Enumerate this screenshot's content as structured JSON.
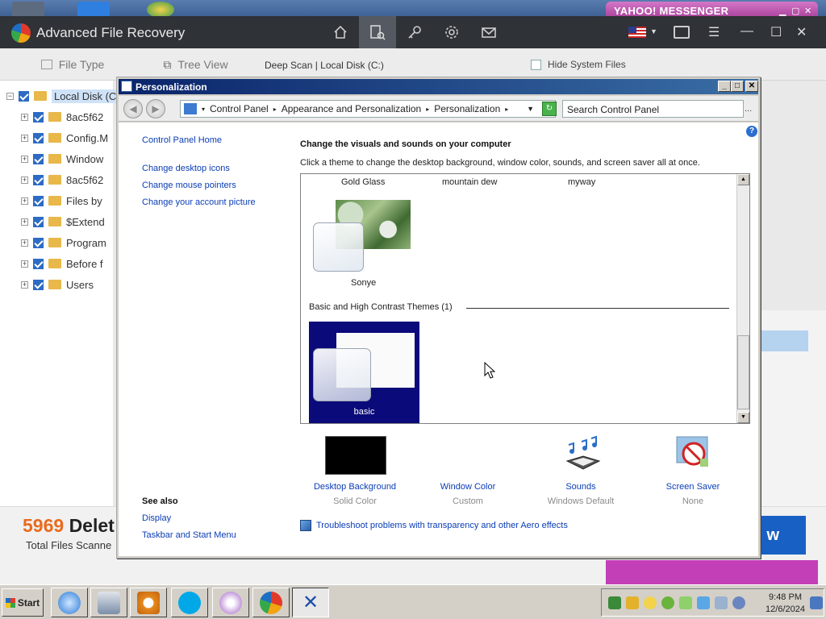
{
  "yahoo": {
    "title": "YAHOO! MESSENGER"
  },
  "afr": {
    "title": "Advanced File Recovery",
    "tabs": {
      "file_type": "File Type",
      "tree_view": "Tree View"
    },
    "path": "Deep Scan  |  Local Disk (C:)",
    "hide_system_files": "Hide System Files",
    "tree": [
      {
        "label": "Local Disk (C"
      },
      {
        "label": "8ac5f62"
      },
      {
        "label": "Config.M"
      },
      {
        "label": "Window"
      },
      {
        "label": "8ac5f62"
      },
      {
        "label": "Files by"
      },
      {
        "label": "$Extend"
      },
      {
        "label": "Program"
      },
      {
        "label": "Before f"
      },
      {
        "label": "Users"
      }
    ],
    "deleted_count": "5969",
    "deleted_suffix": "Delet",
    "total_scanned": "Total Files Scanne",
    "action_button": "w"
  },
  "window": {
    "title": "Personalization",
    "breadcrumb": [
      "Control Panel",
      "Appearance and Personalization",
      "Personalization"
    ],
    "search_placeholder": "Search Control Panel",
    "left_links": [
      "Control Panel Home",
      "Change desktop icons",
      "Change mouse pointers",
      "Change your account picture"
    ],
    "see_also": {
      "heading": "See also",
      "items": [
        "Display",
        "Taskbar and Start Menu"
      ]
    },
    "heading": "Change the visuals and sounds on your computer",
    "description": "Click a theme to change the desktop background, window color, sounds, and screen saver all at once.",
    "themes_top": [
      "Gold Glass",
      "mountain dew",
      "myway"
    ],
    "theme_sonye": "Sonye",
    "basic_group": "Basic and High Contrast Themes (1)",
    "theme_basic": "basic",
    "options": [
      {
        "label": "Desktop Background",
        "sub": "Solid Color",
        "icon": "desktop-background-icon"
      },
      {
        "label": "Window Color",
        "sub": "Custom",
        "icon": "window-color-icon"
      },
      {
        "label": "Sounds",
        "sub": "Windows Default",
        "icon": "sounds-icon"
      },
      {
        "label": "Screen Saver",
        "sub": "None",
        "icon": "screen-saver-icon"
      }
    ],
    "troubleshoot": "Troubleshoot problems with transparency and other Aero effects",
    "desktop_bg_color": "#000000",
    "selected_theme_color": "#0a0a7a"
  },
  "taskbar": {
    "start": "Start",
    "time": "9:48 PM",
    "date": "12/6/2024"
  }
}
